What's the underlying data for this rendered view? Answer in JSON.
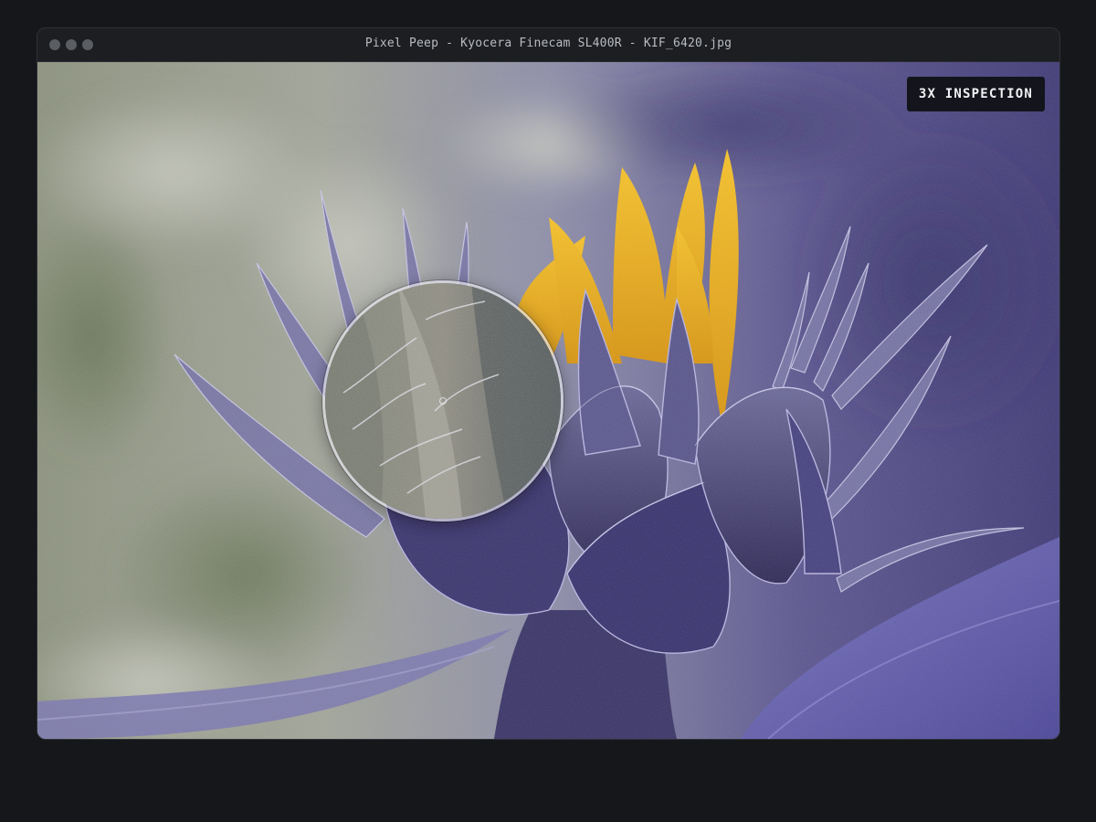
{
  "window": {
    "title": "Pixel Peep - Kyocera Finecam SL400R - KIF_6420.jpg",
    "controls": [
      "close",
      "minimize",
      "maximize"
    ]
  },
  "viewer": {
    "badge_label": "3X INSPECTION",
    "magnification": 3,
    "subject": "sunflower bud"
  },
  "colors": {
    "app_background": "#15171a",
    "titlebar": "#1c1e21",
    "badge_background": "#14151c",
    "petal_yellow": "#f2b21c",
    "bud_purple": "#4a437a"
  },
  "icons": {
    "traffic_lights": "window-control-dot-icon",
    "loupe_center": "crosshair-icon"
  }
}
